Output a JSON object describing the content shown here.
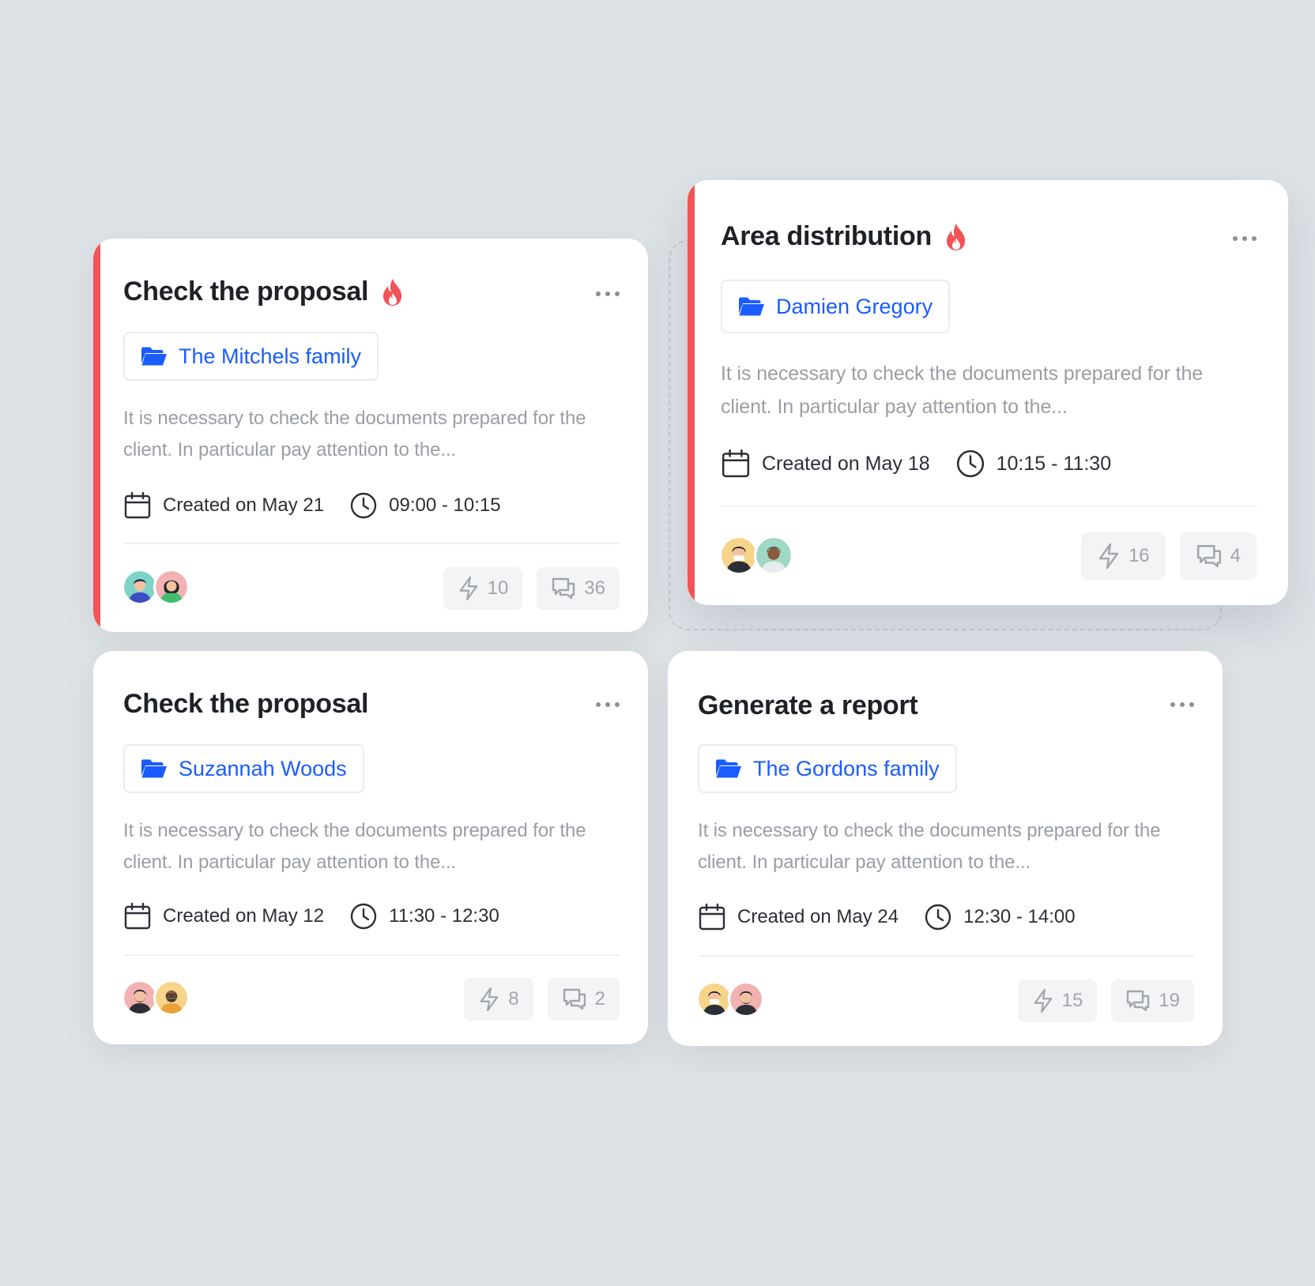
{
  "cards": [
    {
      "title": "Check the proposal",
      "urgent": true,
      "client": "The Mitchels family",
      "description": "It is necessary to check the documents prepared for the client. In particular pay attention to the...",
      "created": "Created on May 21",
      "time": "09:00 - 10:15",
      "tasks": "10",
      "comments": "36"
    },
    {
      "title": "Area distribution",
      "urgent": true,
      "client": "Damien Gregory",
      "description": "It is necessary to check the documents prepared for the client. In particular pay attention to the...",
      "created": "Created on May 18",
      "time": "10:15 - 11:30",
      "tasks": "16",
      "comments": "4"
    },
    {
      "title": "Check the proposal",
      "urgent": false,
      "client": "Suzannah Woods",
      "description": "It is necessary to check the documents prepared for the client. In particular pay attention to the...",
      "created": "Created on May 12",
      "time": "11:30 - 12:30",
      "tasks": "8",
      "comments": "2"
    },
    {
      "title": "Generate a report",
      "urgent": false,
      "client": "The Gordons family",
      "description": "It is necessary to check the documents prepared for the client. In particular pay attention to the...",
      "created": "Created on May 24",
      "time": "12:30 - 14:00",
      "tasks": "15",
      "comments": "19"
    }
  ],
  "colors": {
    "accent": "#1a5cff",
    "urgent": "#f25357",
    "background": "#dde2e6"
  },
  "icons": [
    "fire-icon",
    "folder-icon",
    "calendar-icon",
    "clock-icon",
    "bolt-icon",
    "comment-icon",
    "more-icon"
  ]
}
